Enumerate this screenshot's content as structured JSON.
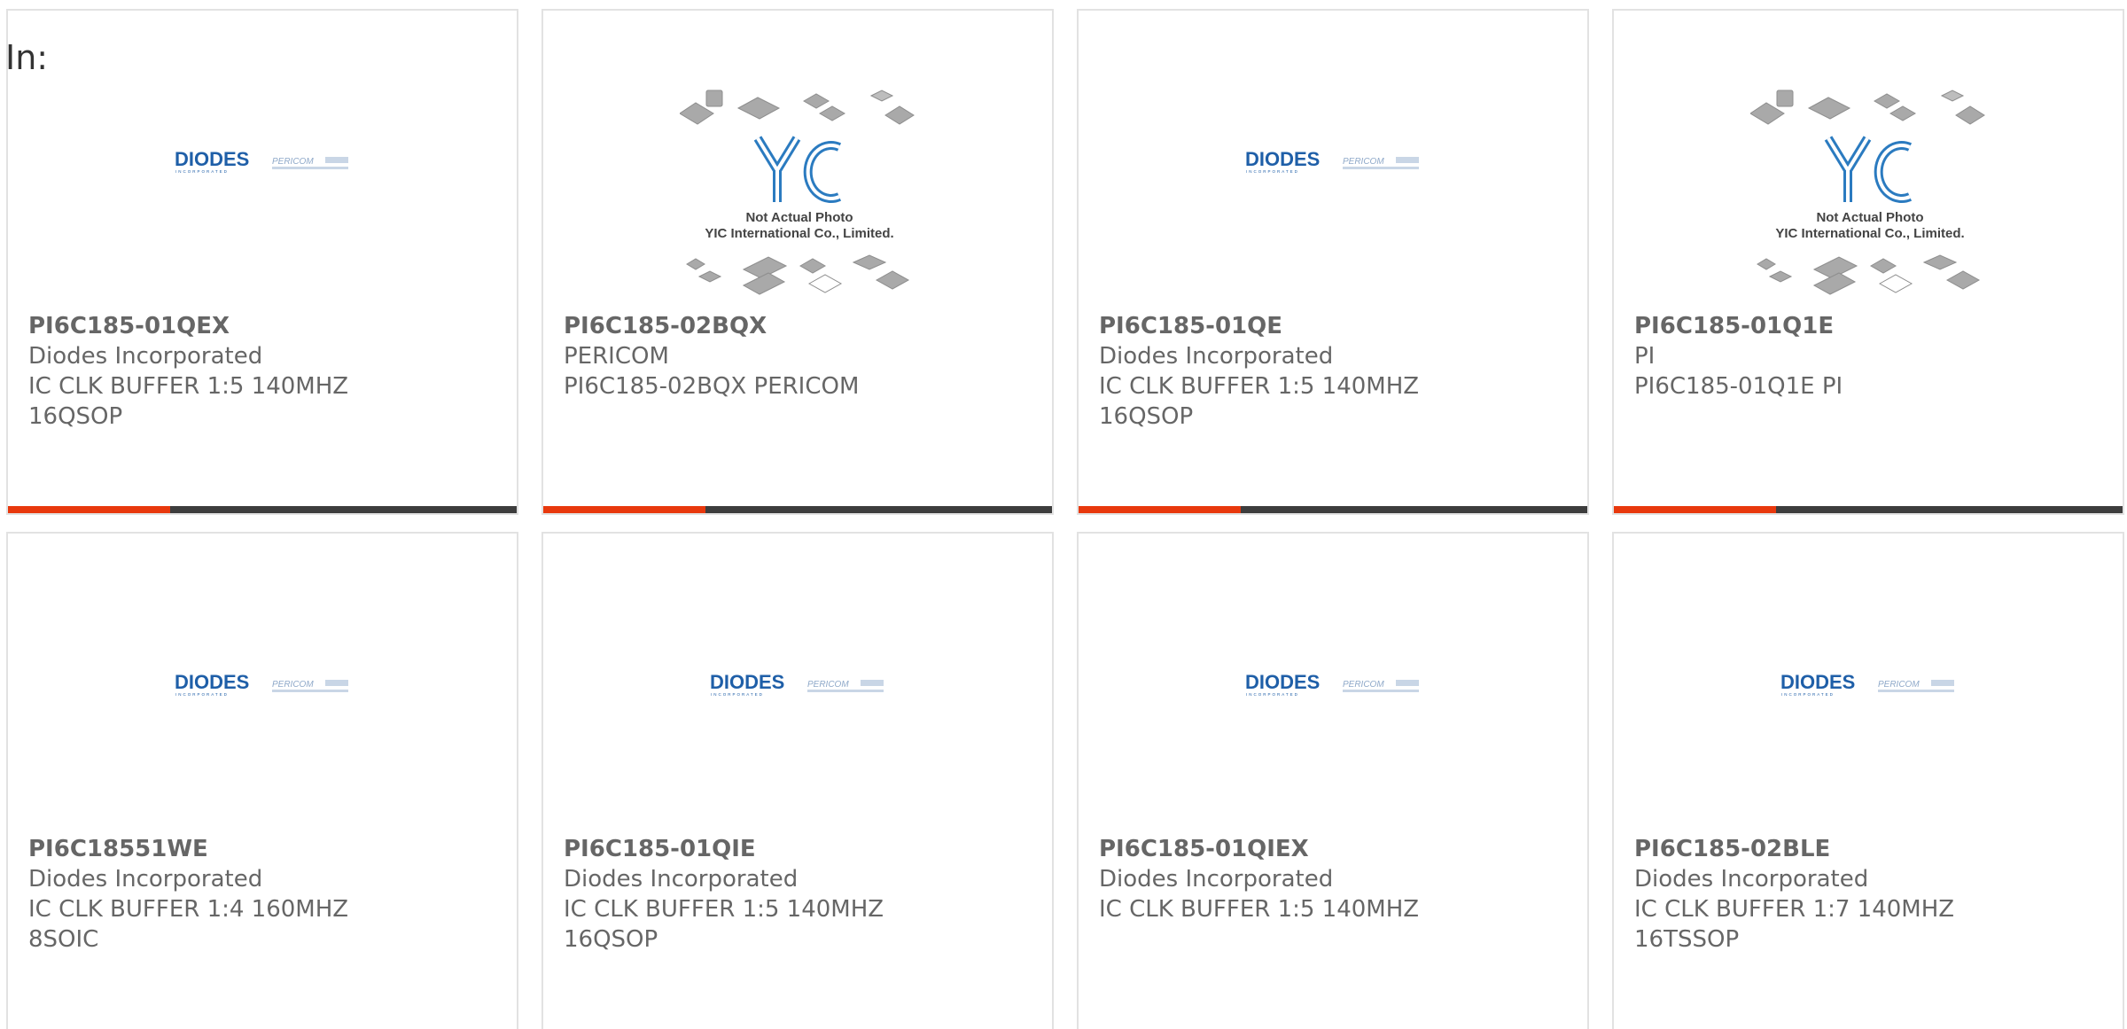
{
  "header": {
    "label": "In:"
  },
  "colors": {
    "accent": "#e8380d",
    "bar": "#3d3d3d",
    "diodes_blue": "#1f5fa8",
    "text": "#666666"
  },
  "products": [
    {
      "part_no": "PI6C185-01QEX",
      "manufacturer": "Diodes Incorporated",
      "desc_line1": "IC CLK BUFFER 1:5 140MHZ",
      "desc_line2": "16QSOP",
      "image": "diodes-pericom-logo"
    },
    {
      "part_no": "PI6C185-02BQX",
      "manufacturer": "PERICOM",
      "desc_line1": "PI6C185-02BQX PERICOM",
      "desc_line2": "",
      "image": "yic-placeholder"
    },
    {
      "part_no": "PI6C185-01QE",
      "manufacturer": "Diodes Incorporated",
      "desc_line1": "IC CLK BUFFER 1:5 140MHZ",
      "desc_line2": "16QSOP",
      "image": "diodes-pericom-logo"
    },
    {
      "part_no": "PI6C185-01Q1E",
      "manufacturer": "PI",
      "desc_line1": "PI6C185-01Q1E PI",
      "desc_line2": "",
      "image": "yic-placeholder"
    },
    {
      "part_no": "PI6C18551WE",
      "manufacturer": "Diodes Incorporated",
      "desc_line1": "IC CLK BUFFER 1:4 160MHZ",
      "desc_line2": "8SOIC",
      "image": "diodes-pericom-logo"
    },
    {
      "part_no": "PI6C185-01QIE",
      "manufacturer": "Diodes Incorporated",
      "desc_line1": "IC CLK BUFFER 1:5 140MHZ",
      "desc_line2": "16QSOP",
      "image": "diodes-pericom-logo"
    },
    {
      "part_no": "PI6C185-01QIEX",
      "manufacturer": "Diodes Incorporated",
      "desc_line1": "IC CLK BUFFER 1:5 140MHZ",
      "desc_line2": "",
      "image": "diodes-pericom-logo"
    },
    {
      "part_no": "PI6C185-02BLE",
      "manufacturer": "Diodes Incorporated",
      "desc_line1": "IC CLK BUFFER 1:7 140MHZ",
      "desc_line2": "16TSSOP",
      "image": "diodes-pericom-logo"
    }
  ],
  "logo": {
    "brand1": "DIODES",
    "brand1_sub": "INCORPORATED",
    "brand2": "PERICOM"
  },
  "yic": {
    "line1": "Not Actual Photo",
    "line2": "YIC International Co., Limited."
  }
}
